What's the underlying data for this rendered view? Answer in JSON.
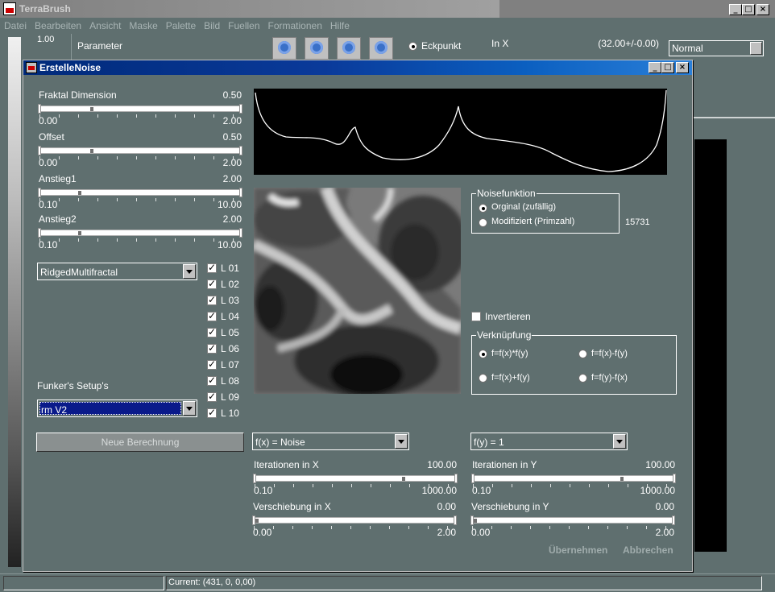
{
  "app": {
    "title": "TerraBrush",
    "menu": [
      "Datei",
      "Bearbeiten",
      "Ansicht",
      "Maske",
      "Palette",
      "Bild",
      "Fuellen",
      "Formationen",
      "Hilfe"
    ],
    "strip_value": "1.00",
    "param_label": "Parameter",
    "eckpunkt_label": "Eckpunkt",
    "in_x_label": "In X",
    "in_x_value": "(32.00+/-0.00)",
    "blend_mode": "Normal",
    "status": "Current: (431, 0, 0,00)"
  },
  "dialog": {
    "title": "ErstelleNoise",
    "sliders_left": [
      {
        "label": "Fraktal Dimension",
        "value": "0.50",
        "min": "0.00",
        "max": "2.00",
        "fraction": 0.25
      },
      {
        "label": "Offset",
        "value": "0.50",
        "min": "0.00",
        "max": "2.00",
        "fraction": 0.25
      },
      {
        "label": "Anstieg1",
        "value": "2.00",
        "min": "0.10",
        "max": "10.00",
        "fraction": 0.19
      },
      {
        "label": "Anstieg2",
        "value": "2.00",
        "min": "0.10",
        "max": "10.00",
        "fraction": 0.19
      }
    ],
    "noise_type": "RidgedMultifractal",
    "layers": [
      "L 01",
      "L 02",
      "L 03",
      "L 04",
      "L 05",
      "L 06",
      "L 07",
      "L 08",
      "L 09",
      "L 10"
    ],
    "setups_label": "Funker's Setup's",
    "setup_value": "rm V2",
    "neue_berechnung": "Neue Berechnung",
    "noisefunktion": {
      "title": "Noisefunktion",
      "options": [
        "Orginal (zufällig)",
        "Modifiziert (Primzahl)"
      ],
      "selected": 0,
      "seed": "15731"
    },
    "invertieren": "Invertieren",
    "verknuepfung": {
      "title": "Verknüpfung",
      "options": [
        "f=f(x)*f(y)",
        "f=f(x)-f(y)",
        "f=f(x)+f(y)",
        "f=f(y)-f(x)"
      ],
      "selected": 0
    },
    "fx": {
      "combo": "f(x) = Noise",
      "iter_label": "Iterationen in X",
      "iter_value": "100.00",
      "iter_min": "0.10",
      "iter_max": "1000.00",
      "iter_fraction": 0.74,
      "shift_label": "Verschiebung in X",
      "shift_value": "0.00",
      "shift_min": "0.00",
      "shift_max": "2.00",
      "shift_fraction": 0.0
    },
    "fy": {
      "combo": "f(y) = 1",
      "iter_label": "Iterationen in Y",
      "iter_value": "100.00",
      "iter_min": "0.10",
      "iter_max": "1000.00",
      "iter_fraction": 0.74,
      "shift_label": "Verschiebung in Y",
      "shift_value": "0.00",
      "shift_min": "0.00",
      "shift_max": "2.00",
      "shift_fraction": 0.0
    },
    "uebernehmen": "Übernehmen",
    "abbrechen": "Abbrechen"
  }
}
